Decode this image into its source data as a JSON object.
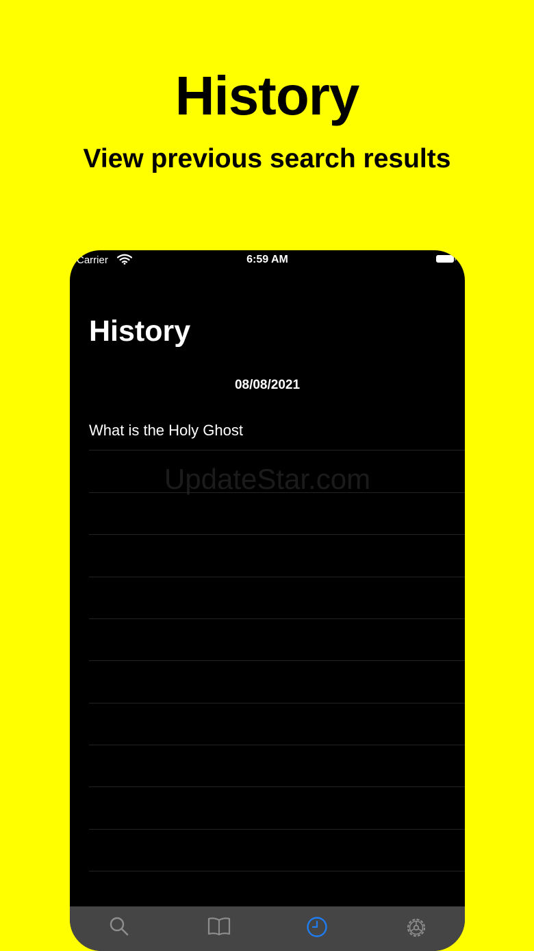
{
  "promo": {
    "title": "History",
    "subtitle": "View previous search results"
  },
  "status_bar": {
    "carrier": "Carrier",
    "time": "6:59 AM",
    "icons": [
      "wifi-icon",
      "battery-icon"
    ]
  },
  "screen": {
    "title": "History",
    "section_date": "08/08/2021",
    "rows": [
      "What is the Holy Ghost"
    ],
    "watermark": "UpdateStar.com"
  },
  "tab_bar": {
    "active_color": "#1f7cf2",
    "inactive_color": "#8e8e8e",
    "tabs": [
      {
        "icon": "search-icon",
        "active": false
      },
      {
        "icon": "book-icon",
        "active": false
      },
      {
        "icon": "clock-icon",
        "active": true
      },
      {
        "icon": "gear-icon",
        "active": false
      }
    ]
  },
  "colors": {
    "background": "#ffff00",
    "phone_background": "#000000",
    "tab_bar_background": "#454545"
  }
}
